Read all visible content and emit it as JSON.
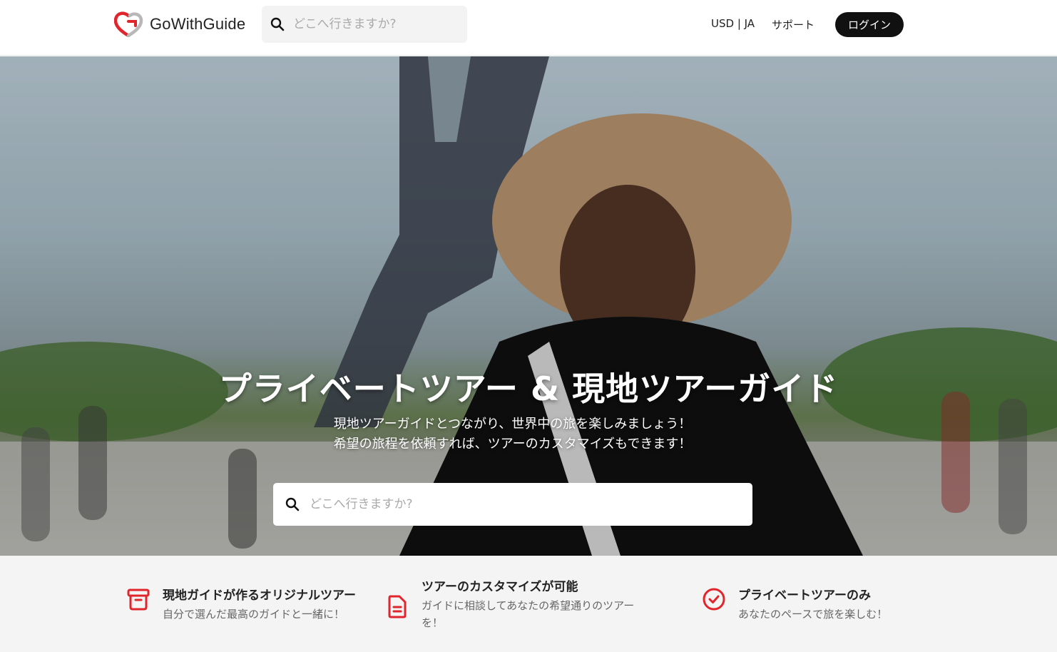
{
  "header": {
    "logo_text": "GoWithGuide",
    "search_placeholder": "どこへ行きますか?",
    "currency_lang": "USD | JA",
    "support": "サポート",
    "login": "ログイン"
  },
  "hero": {
    "title": "プライベートツアー & 現地ツアーガイド",
    "subtitle_line1": "現地ツアーガイドとつながり、世界中の旅を楽しみましょう！",
    "subtitle_line2": "希望の旅程を依頼すれば、ツアーのカスタマイズもできます！",
    "search_placeholder": "どこへ行きますか?"
  },
  "features": [
    {
      "icon": "archive-box-icon",
      "title": "現地ガイドが作るオリジナルツアー",
      "desc": "自分で選んだ最高のガイドと一緒に！"
    },
    {
      "icon": "document-icon",
      "title": "ツアーのカスタマイズが可能",
      "desc": "ガイドに相談してあなたの希望通りのツアーを！"
    },
    {
      "icon": "check-circle-icon",
      "title": "プライベートツアーのみ",
      "desc": "あなたのペースで旅を楽しむ！"
    }
  ],
  "colors": {
    "brand_red": "#e0262c",
    "login_bg": "#111111",
    "feature_bg": "#f4f4f4"
  }
}
